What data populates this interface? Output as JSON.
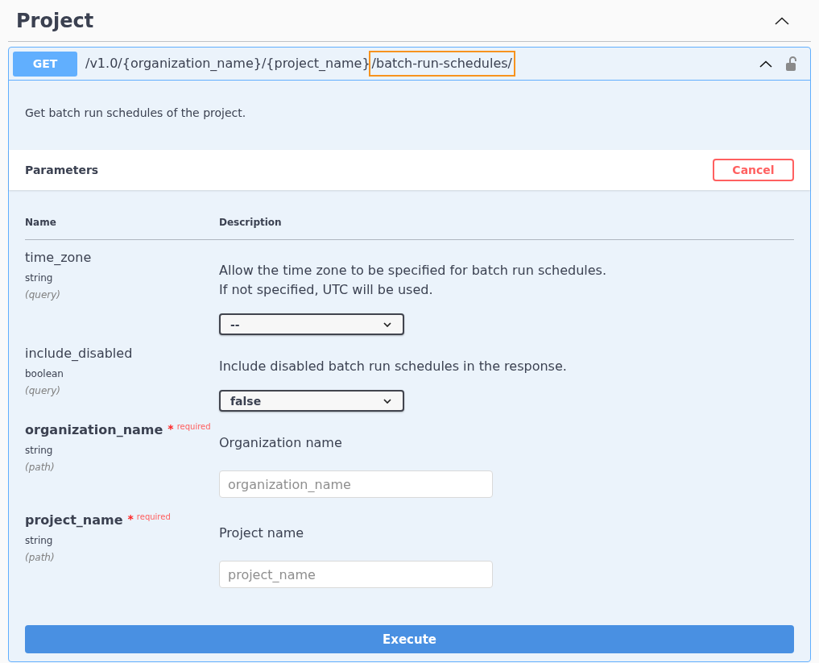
{
  "section": {
    "title": "Project",
    "expanded": true
  },
  "operation": {
    "method": "GET",
    "path": [
      {
        "text": "/v1.0/{organization_name}/{project_name}",
        "highlighted": false
      },
      {
        "text": "/batch-run-schedules/",
        "highlighted": true
      }
    ],
    "expanded": true,
    "locked": false,
    "description": "Get batch run schedules of the project."
  },
  "parameters": {
    "title": "Parameters",
    "cancel_button": "Cancel",
    "columns": [
      "Name",
      "Description"
    ],
    "rows": [
      {
        "name": "time_zone",
        "required": false,
        "type": "string",
        "location": "(query)",
        "description": [
          "Allow the time zone to be specified for batch run schedules.",
          "If not specified, UTC will be used."
        ],
        "field": {
          "kind": "select",
          "value": "--"
        }
      },
      {
        "name": "include_disabled",
        "required": false,
        "type": "boolean",
        "location": "(query)",
        "description": [
          "Include disabled batch run schedules in the response."
        ],
        "field": {
          "kind": "select",
          "value": "false"
        }
      },
      {
        "name": "organization_name",
        "required": true,
        "required_mark": "*",
        "required_label": "required",
        "type": "string",
        "location": "(path)",
        "description": [
          "Organization name"
        ],
        "field": {
          "kind": "text",
          "placeholder": "organization_name"
        }
      },
      {
        "name": "project_name",
        "required": true,
        "required_mark": "*",
        "required_label": "required",
        "type": "string",
        "location": "(path)",
        "description": [
          "Project name"
        ],
        "field": {
          "kind": "text",
          "placeholder": "project_name"
        }
      }
    ]
  },
  "execute_button": "Execute"
}
